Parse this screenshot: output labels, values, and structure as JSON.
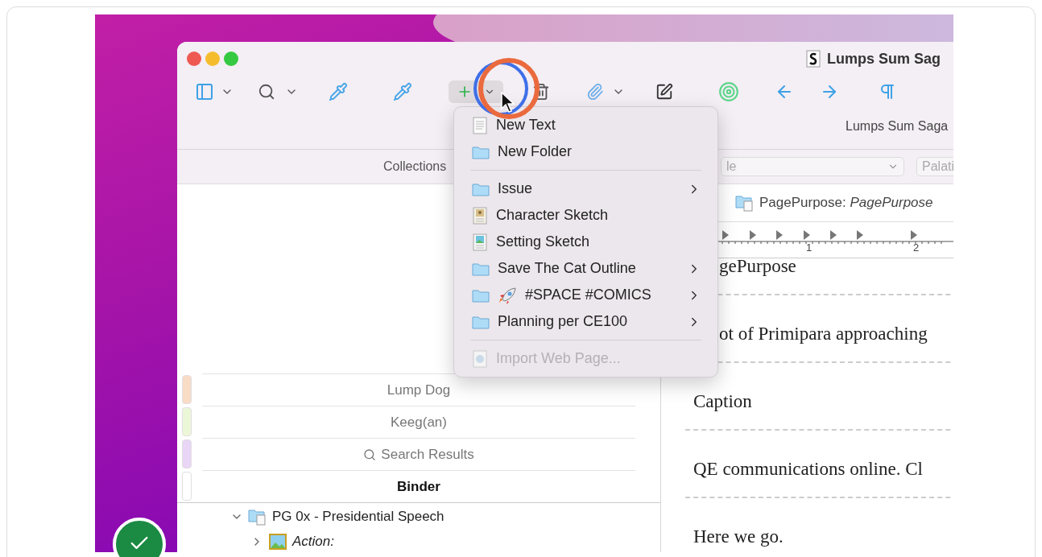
{
  "window": {
    "title": "Lumps Sum Sag",
    "subtitle": "Lumps Sum Saga"
  },
  "add_menu": {
    "items": [
      {
        "kind": "text",
        "label": "New Text",
        "submenu": false,
        "disabled": false
      },
      {
        "kind": "folder",
        "label": "New Folder",
        "submenu": false,
        "disabled": false
      },
      {
        "kind": "separator"
      },
      {
        "kind": "folder",
        "label": "Issue",
        "submenu": true,
        "disabled": false
      },
      {
        "kind": "character",
        "label": "Character Sketch",
        "submenu": false,
        "disabled": false
      },
      {
        "kind": "setting",
        "label": "Setting Sketch",
        "submenu": false,
        "disabled": false
      },
      {
        "kind": "folder",
        "label": "Save The Cat Outline",
        "submenu": true,
        "disabled": false
      },
      {
        "kind": "folder",
        "label": "#SPACE #COMICS",
        "rocket": true,
        "submenu": true,
        "disabled": false
      },
      {
        "kind": "folder",
        "label": "Planning per CE100",
        "submenu": true,
        "disabled": false
      },
      {
        "kind": "separator"
      },
      {
        "kind": "web",
        "label": "Import Web Page...",
        "submenu": false,
        "disabled": true
      }
    ]
  },
  "sidebar": {
    "header": "Collections",
    "collections": [
      {
        "label": "Lump Dog",
        "color": "#f9dcc6",
        "kind": "plain",
        "selected": false
      },
      {
        "label": "Keeg(an)",
        "color": "#ecf7d8",
        "kind": "plain",
        "selected": false
      },
      {
        "label": "Search Results",
        "color": "#e9d6f6",
        "kind": "search",
        "selected": false
      },
      {
        "label": "Binder",
        "color": "#ffffff",
        "kind": "plain",
        "selected": true
      }
    ],
    "binder": [
      {
        "label": "PG 0x - Presidential Speech",
        "kind": "folder",
        "expanded": true,
        "children": [
          {
            "label": "Action:",
            "kind": "image",
            "expanded": false
          }
        ]
      }
    ]
  },
  "editor": {
    "style_field": "le",
    "font_field": "Palati",
    "header": "PagePurpose: *PagePurpose*",
    "ruler_labels": [
      "1",
      "2"
    ],
    "paragraphs": [
      {
        "text": "gePurpose",
        "covered": true
      },
      {
        "text": "ot of Primipara approaching",
        "covered": true
      },
      {
        "text": "Caption",
        "covered": false
      },
      {
        "text": "QE communications online. Cl",
        "covered": false
      },
      {
        "text": "Here we go.",
        "covered": false
      }
    ]
  }
}
